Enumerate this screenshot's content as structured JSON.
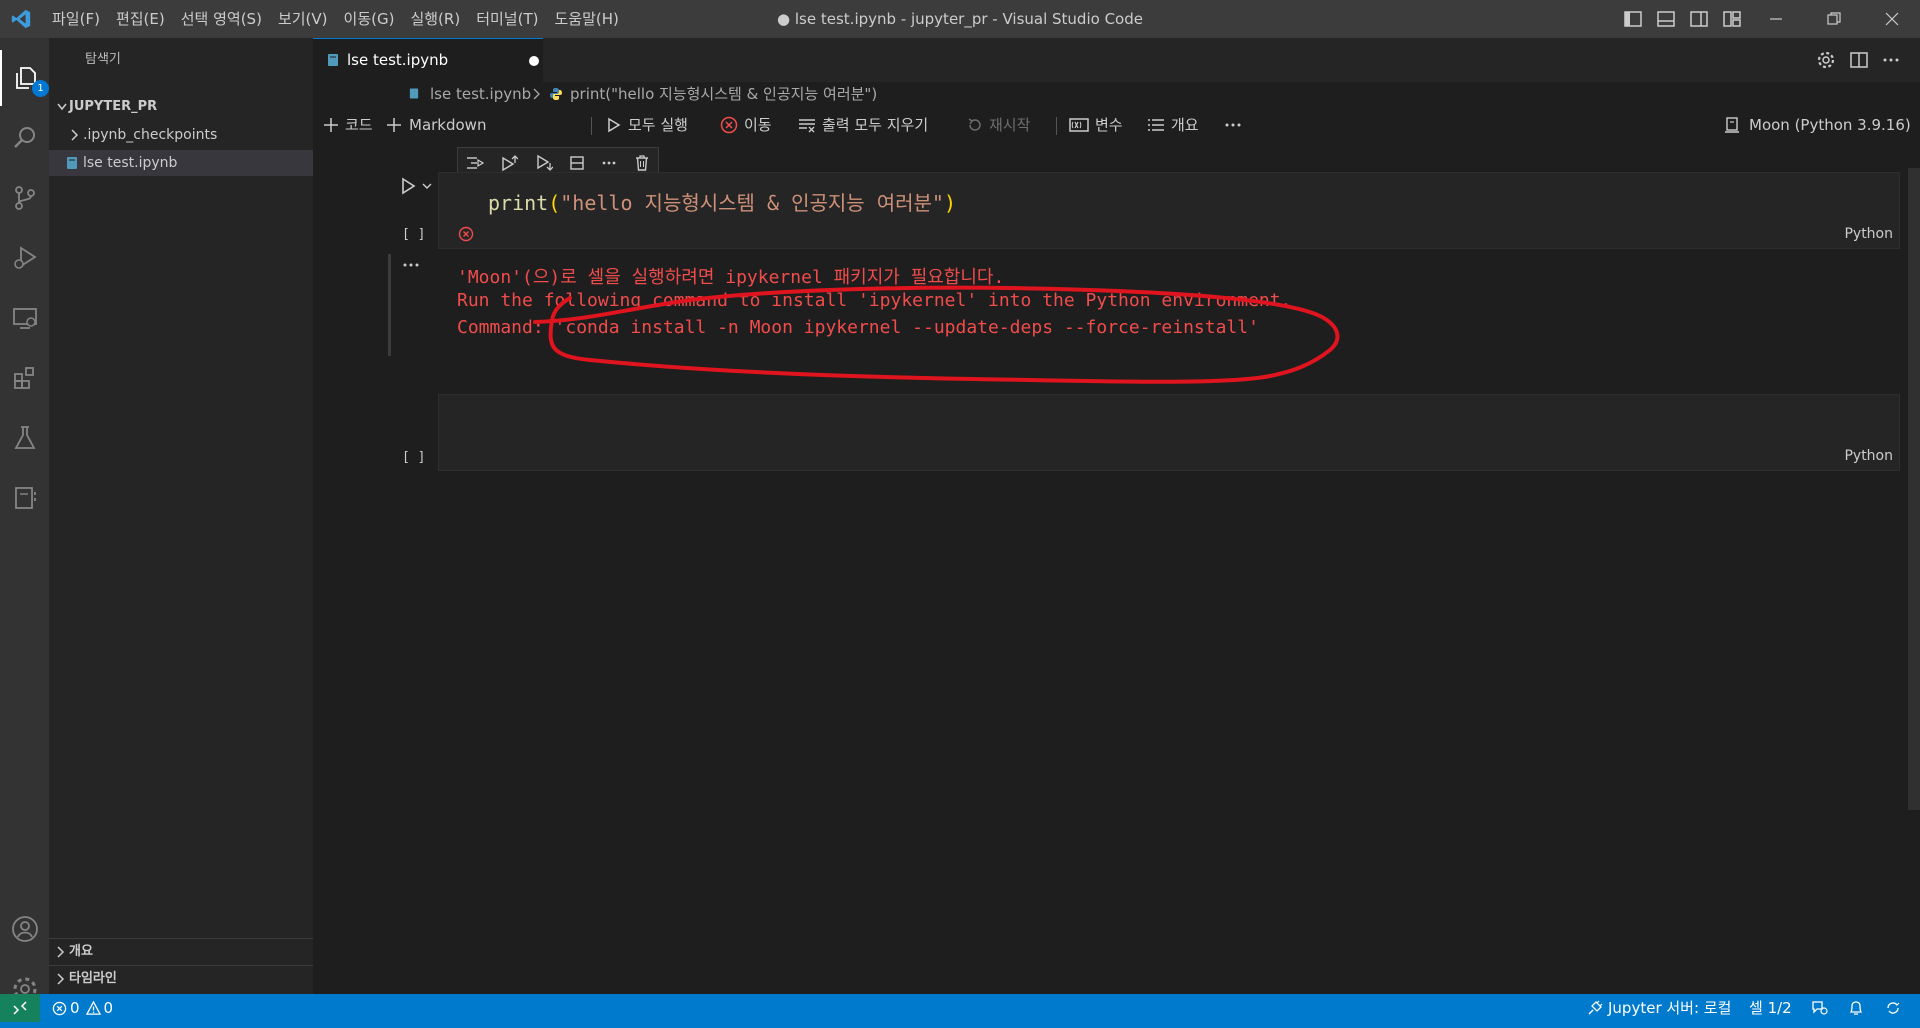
{
  "window": {
    "title": "● lse test.ipynb - jupyter_pr - Visual Studio Code",
    "menu": [
      "파일(F)",
      "편집(E)",
      "선택 영역(S)",
      "보기(V)",
      "이동(G)",
      "실행(R)",
      "터미널(T)",
      "도움말(H)"
    ]
  },
  "activity_bar": {
    "explorer_badge": "1",
    "items": [
      "explorer-icon",
      "search-icon",
      "source-control-icon",
      "run-debug-icon",
      "remote-explorer-icon",
      "extensions-icon",
      "testing-icon",
      "jupyter-icon"
    ]
  },
  "sidebar": {
    "title": "탐색기",
    "folder": "JUPYTER_PR",
    "items": [
      {
        "label": ".ipynb_checkpoints",
        "type": "folder"
      },
      {
        "label": "lse test.ipynb",
        "type": "file"
      }
    ],
    "sections": [
      "개요",
      "타임라인"
    ]
  },
  "editor": {
    "tab_label": "lse test.ipynb",
    "breadcrumb": [
      "lse test.ipynb",
      "print(\"hello 지능형시스템 & 인공지능 여러분\")"
    ],
    "toolbar": {
      "code": "코드",
      "markdown": "Markdown",
      "run_all": "모두 실행",
      "goto": "이동",
      "clear_outputs": "출력 모두 지우기",
      "restart": "재시작",
      "variables": "변수",
      "outline": "개요",
      "kernel": "Moon (Python 3.9.16)"
    },
    "cell1": {
      "exec": "[ ]",
      "code_fn": "print",
      "code_str": "\"hello 지능형시스템 & 인공지능 여러분\"",
      "language": "Python",
      "output_lines": [
        "'Moon'(으)로 셀을 실행하려면 ipykernel 패키지가 필요합니다.",
        "Run the following command to install 'ipykernel' into the Python environment.",
        "Command: 'conda install -n Moon ipykernel --update-deps --force-reinstall'"
      ]
    },
    "cell2": {
      "exec": "[ ]",
      "language": "Python"
    },
    "annotation_color": "#e0141e"
  },
  "status_bar": {
    "errors": "0",
    "warnings": "0",
    "jupyter_server": "Jupyter 서버: 로컬",
    "cell_position": "셀 1/2"
  },
  "colors": {
    "accent": "#007acc",
    "error": "#f14c4c",
    "string": "#ce9178"
  }
}
